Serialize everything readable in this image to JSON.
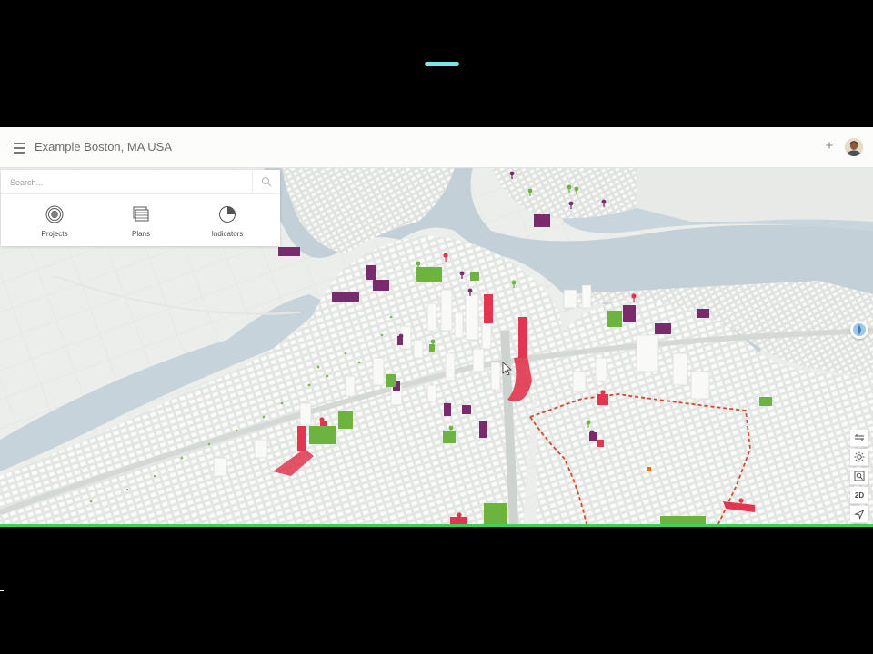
{
  "header": {
    "title": "Example Boston, MA USA",
    "add_label": "+"
  },
  "panel": {
    "search_placeholder": "Search...",
    "nav": [
      {
        "label": "Projects",
        "icon": "projects-icon"
      },
      {
        "label": "Plans",
        "icon": "plans-icon"
      },
      {
        "label": "Indicators",
        "icon": "indicators-icon"
      }
    ]
  },
  "toolbar": {
    "view_mode_label": "2D",
    "tools": [
      "layers-icon",
      "daylight-icon",
      "zoom-to-icon",
      "2d-toggle",
      "locate-icon"
    ]
  },
  "colors": {
    "accent_line": "#3bd35c",
    "top_indicator": "#7fe3ea",
    "water": "#c6d3da",
    "land": "#eef0ee",
    "buildings": "#f7f7f6",
    "project_red": "#e0364f",
    "project_purple": "#7a2b6e",
    "project_green": "#6cb43f",
    "district_boundary": "#d9472b"
  }
}
